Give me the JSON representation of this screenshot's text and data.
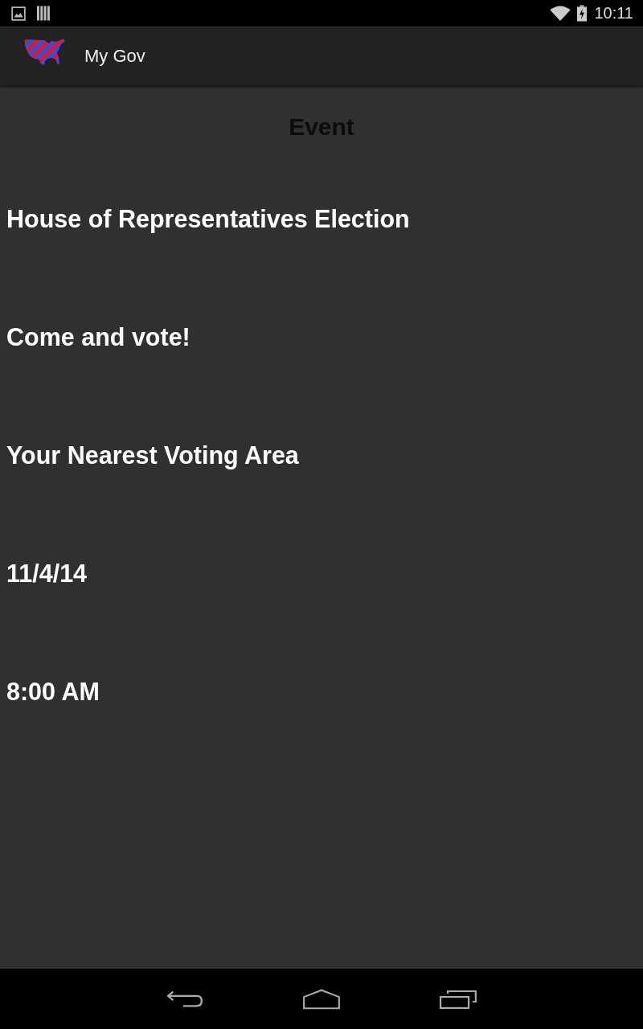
{
  "status_bar": {
    "time": "10:11"
  },
  "app_bar": {
    "title": "My Gov"
  },
  "event": {
    "heading": "Event",
    "lines": [
      "House of Representatives Election",
      "Come and vote!",
      "Your Nearest Voting Area",
      "11/4/14",
      "8:00 AM"
    ]
  }
}
